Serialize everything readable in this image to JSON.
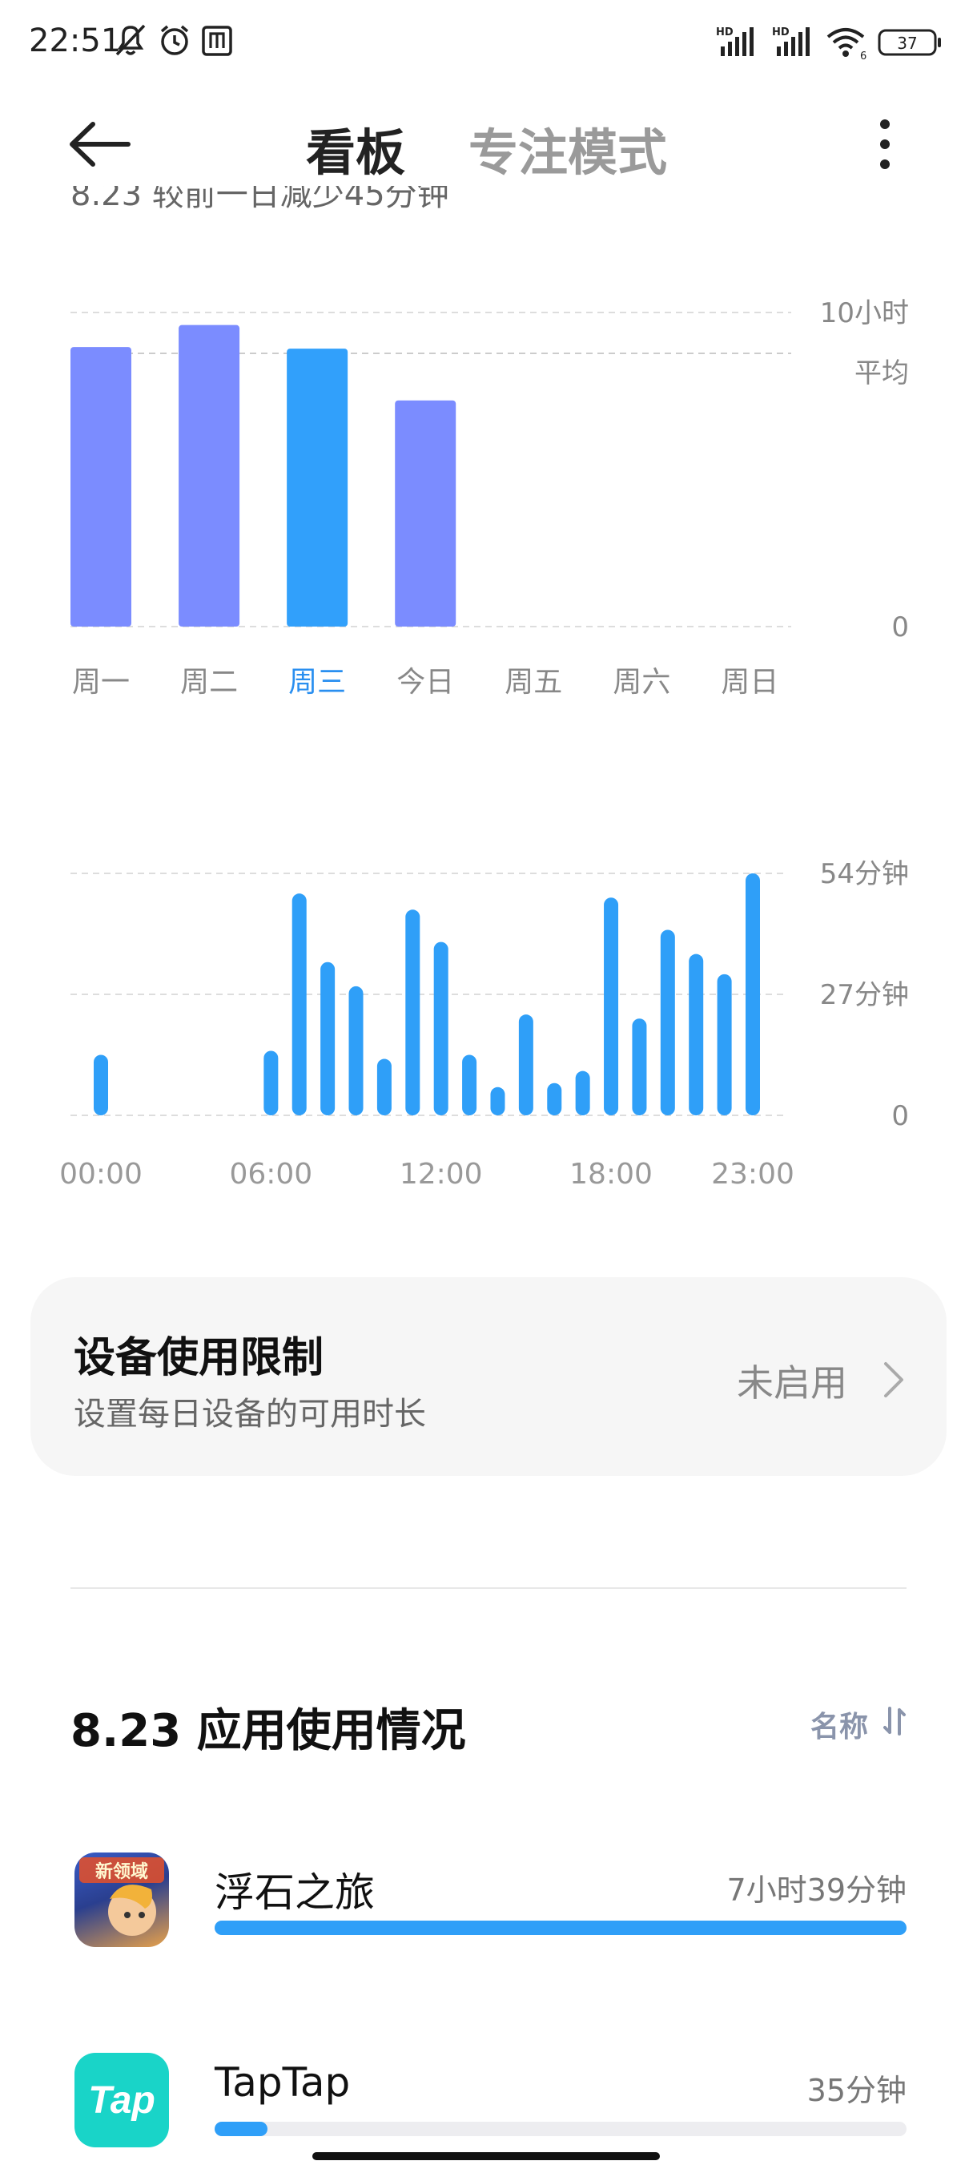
{
  "status_bar": {
    "time": "22:51",
    "icons": [
      "bell-off-icon",
      "alarm-icon",
      "nfc-icon",
      "signal-hd-icon",
      "signal-hd-icon",
      "wifi-icon",
      "battery-icon"
    ],
    "hd_label_1": "HD",
    "hd_label_2": "HD",
    "wifi_label": "6",
    "battery_level": "37"
  },
  "header": {
    "back_icon": "back-arrow-icon",
    "tabs": [
      {
        "label": "看板",
        "active": true
      },
      {
        "label": "专注模式",
        "active": false
      }
    ],
    "more_icon": "more-vertical-icon"
  },
  "summary_text": "8.23 较前一日减少45分钟",
  "chart_data": [
    {
      "type": "bar",
      "categories": [
        "周一",
        "周二",
        "周三",
        "今日",
        "周五",
        "周六",
        "周日"
      ],
      "values": [
        8.9,
        9.6,
        8.85,
        7.2,
        null,
        null,
        null
      ],
      "highlight_index": 2,
      "ylim": [
        0,
        10
      ],
      "y_ticks": [
        {
          "value": 10,
          "label": "10小时"
        },
        {
          "value": 0,
          "label": "0"
        }
      ],
      "average": {
        "value": 8.7,
        "label": "平均"
      },
      "colors": {
        "default": "#7b8cff",
        "highlight": "#31a0fb",
        "label": "#888888",
        "highlight_label": "#2a8ff0"
      }
    },
    {
      "type": "bar",
      "x": [
        0,
        1,
        2,
        3,
        4,
        5,
        6,
        7,
        8,
        9,
        10,
        11,
        12,
        13,
        14,
        15,
        16,
        17,
        18,
        19,
        20,
        21,
        22,
        23
      ],
      "values": [
        15,
        0,
        0,
        0,
        0,
        0,
        16,
        55,
        38,
        32,
        14,
        51,
        43,
        15,
        7,
        25,
        8,
        11,
        54,
        24,
        46,
        40,
        35,
        60
      ],
      "ylim": [
        0,
        60
      ],
      "y_ticks": [
        {
          "value": 60,
          "label": "54分钟"
        },
        {
          "value": 30,
          "label": "27分钟"
        },
        {
          "value": 0,
          "label": "0"
        }
      ],
      "x_tick_labels": [
        {
          "index": 0,
          "label": "00:00"
        },
        {
          "index": 6,
          "label": "06:00"
        },
        {
          "index": 12,
          "label": "12:00"
        },
        {
          "index": 18,
          "label": "18:00"
        },
        {
          "index": 23,
          "label": "23:00"
        }
      ],
      "color": "#2f9ff8"
    }
  ],
  "device_limit": {
    "title": "设备使用限制",
    "subtitle": "设置每日设备的可用时长",
    "status": "未启用",
    "chevron_icon": "chevron-right-icon"
  },
  "usage": {
    "title": "8.23 应用使用情况",
    "sort_label": "名称",
    "sort_icon": "sort-icon",
    "apps": [
      {
        "name": "浮石之旅",
        "time": "7小时39分钟",
        "ratio": 1.0,
        "icon": "game-app-icon",
        "icon_text": "新领域"
      },
      {
        "name": "TapTap",
        "time": "35分钟",
        "ratio": 0.076,
        "icon": "taptap-app-icon",
        "icon_text": "Tap"
      }
    ]
  }
}
